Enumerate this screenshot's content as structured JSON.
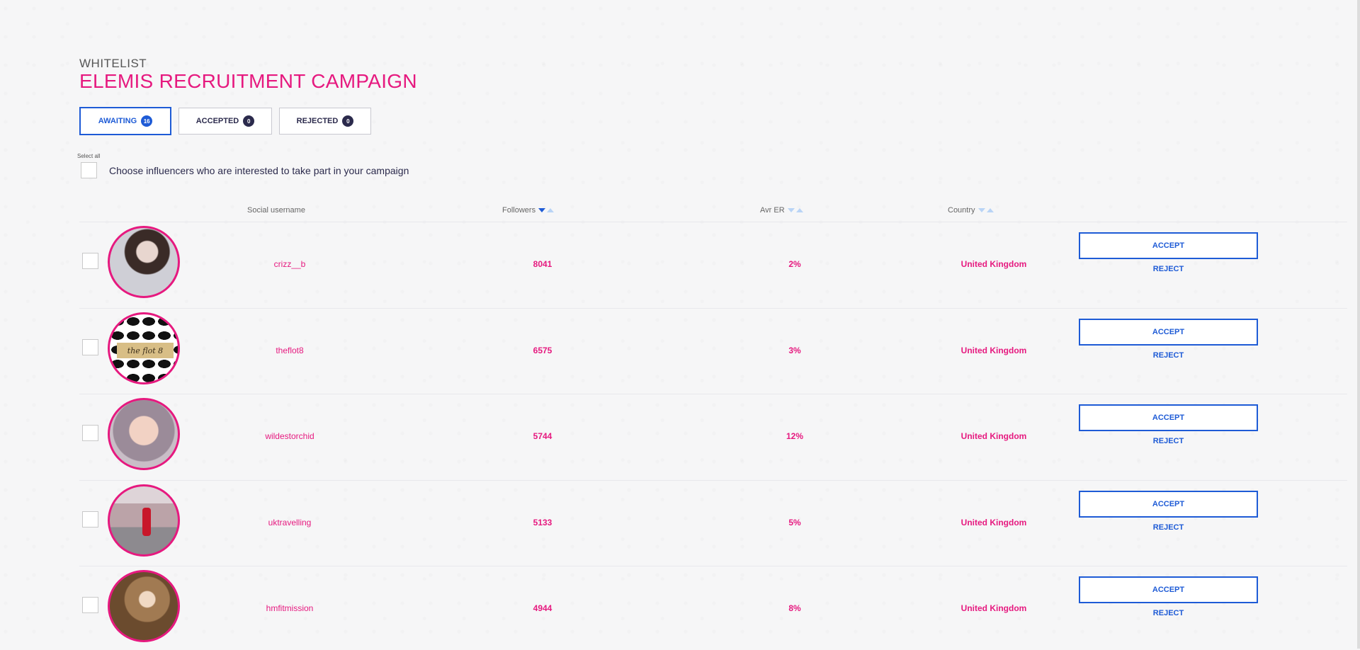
{
  "header": {
    "overline": "WHITELIST",
    "title": "ELEMIS RECRUITMENT CAMPAIGN"
  },
  "tabs": [
    {
      "label": "AWAITING",
      "count": "16",
      "active": true
    },
    {
      "label": "ACCEPTED",
      "count": "0",
      "active": false
    },
    {
      "label": "REJECTED",
      "count": "0",
      "active": false
    }
  ],
  "select_all": {
    "label": "Select all",
    "text": "Choose influencers who are interested to take part in your campaign"
  },
  "columns": {
    "username": "Social username",
    "followers": "Followers",
    "er": "Avr ER",
    "country": "Country"
  },
  "actions": {
    "accept": "ACCEPT",
    "reject": "REJECT"
  },
  "rows": [
    {
      "username": "crizz__b",
      "followers": "8041",
      "er": "2%",
      "country": "United Kingdom"
    },
    {
      "username": "theflot8",
      "followers": "6575",
      "er": "3%",
      "country": "United Kingdom"
    },
    {
      "username": "wildestorchid",
      "followers": "5744",
      "er": "12%",
      "country": "United Kingdom"
    },
    {
      "username": "uktravelling",
      "followers": "5133",
      "er": "5%",
      "country": "United Kingdom"
    },
    {
      "username": "hmfitmission",
      "followers": "4944",
      "er": "8%",
      "country": "United Kingdom"
    }
  ],
  "colors": {
    "accent_pink": "#e6197f",
    "accent_blue": "#1e5bd6",
    "navy": "#2b2a4c"
  }
}
